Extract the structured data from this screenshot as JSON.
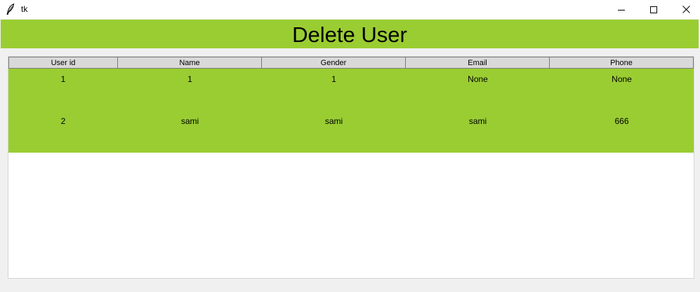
{
  "window": {
    "title": "tk",
    "icon": "feather-icon"
  },
  "header": {
    "title": "Delete User",
    "background": "#9acd32"
  },
  "table": {
    "columns": [
      "User id",
      "Name",
      "Gender",
      "Email",
      "Phone"
    ],
    "row_background": "#9acd32",
    "rows": [
      [
        "1",
        "1",
        "1",
        "None",
        "None"
      ],
      [
        "2",
        "sami",
        "sami",
        "sami",
        "666"
      ]
    ]
  }
}
